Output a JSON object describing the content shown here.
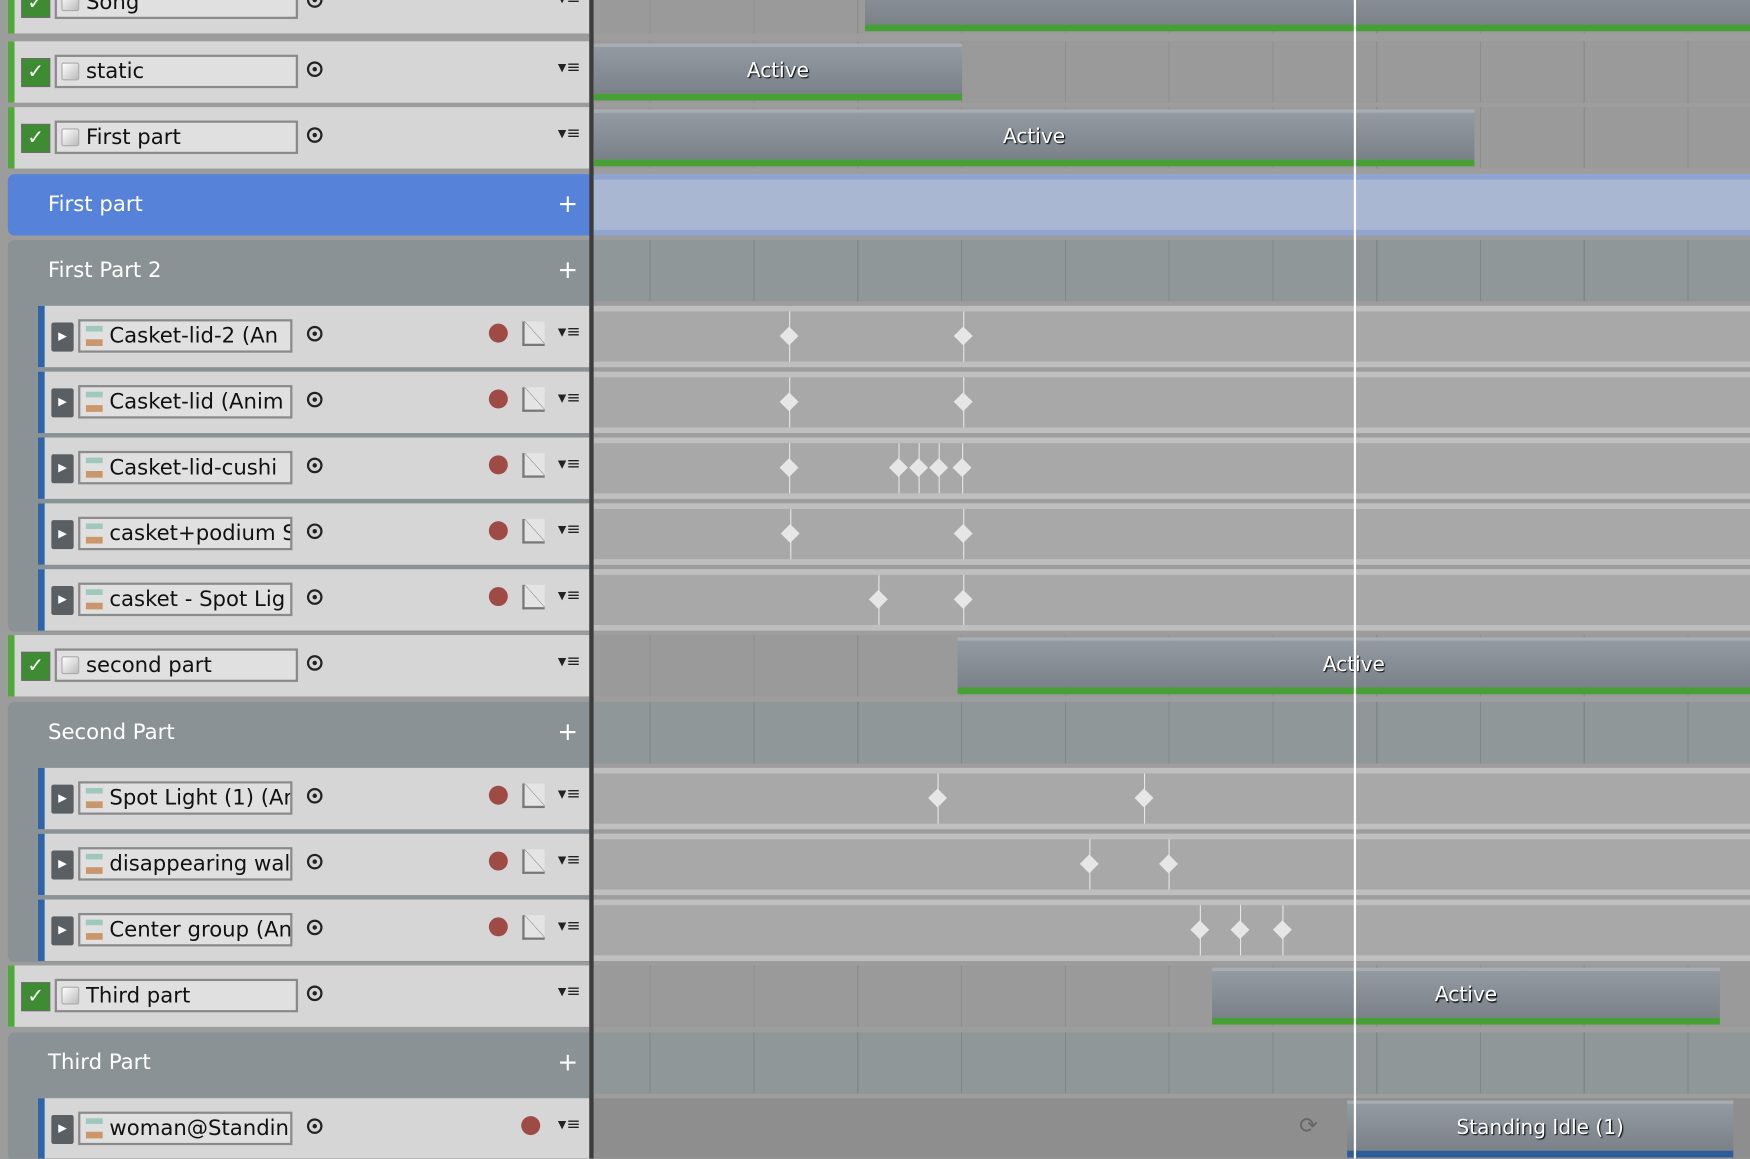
{
  "rows": [
    {
      "type": "activation",
      "label": "Song",
      "bar": {
        "label": ""
      }
    },
    {
      "type": "activation",
      "label": "static",
      "bar": {
        "label": "Active"
      }
    },
    {
      "type": "activation",
      "label": "First part",
      "bar": {
        "label": "Active"
      }
    },
    {
      "type": "group",
      "label": "First part",
      "selected": true,
      "add": "+"
    },
    {
      "type": "group",
      "label": "First Part 2",
      "add": "+"
    },
    {
      "type": "animation",
      "label": "Casket-lid-2 (An"
    },
    {
      "type": "animation",
      "label": "Casket-lid (Anim"
    },
    {
      "type": "animation",
      "label": "Casket-lid-cushi"
    },
    {
      "type": "animation",
      "label": "casket+podium S"
    },
    {
      "type": "animation",
      "label": "casket - Spot Lig"
    },
    {
      "type": "activation",
      "label": "second part",
      "bar": {
        "label": "Active"
      }
    },
    {
      "type": "group",
      "label": "Second Part",
      "add": "+"
    },
    {
      "type": "animation",
      "label": "Spot Light (1) (An"
    },
    {
      "type": "animation",
      "label": "disappearing wal"
    },
    {
      "type": "animation",
      "label": "Center group (An"
    },
    {
      "type": "activation",
      "label": "Third part",
      "bar": {
        "label": "Active"
      }
    },
    {
      "type": "group",
      "label": "Third Part",
      "add": "+"
    },
    {
      "type": "animation",
      "label": "woman@Standin",
      "clip": {
        "label": "Standing Idle (1)"
      },
      "no_curve": true
    }
  ],
  "colors": {
    "activation": "#4faa3a",
    "animation": "#2f64a8",
    "selected_group": "#5683d9",
    "record": "#9e4b46"
  }
}
